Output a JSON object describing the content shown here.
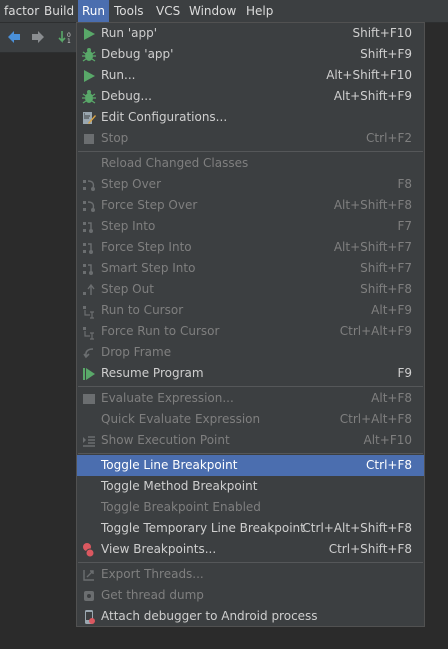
{
  "menubar": {
    "items": [
      {
        "label": "factor"
      },
      {
        "label": "Build"
      },
      {
        "label": "Run"
      },
      {
        "label": "Tools"
      },
      {
        "label": "VCS"
      },
      {
        "label": "Window"
      },
      {
        "label": "Help"
      }
    ]
  },
  "toolbar": {
    "icons": [
      "back-arrow-icon",
      "forward-arrow-icon",
      "sort-icon"
    ]
  },
  "run_menu": {
    "items": [
      {
        "label": "Run 'app'",
        "shortcut": "Shift+F10",
        "icon": "run-icon",
        "enabled": true
      },
      {
        "label": "Debug 'app'",
        "shortcut": "Shift+F9",
        "icon": "debug-icon",
        "enabled": true
      },
      {
        "label": "Run...",
        "shortcut": "Alt+Shift+F10",
        "icon": "run-icon",
        "enabled": true
      },
      {
        "label": "Debug...",
        "shortcut": "Alt+Shift+F9",
        "icon": "debug-icon",
        "enabled": true
      },
      {
        "label": "Edit Configurations...",
        "shortcut": "",
        "icon": "edit-config-icon",
        "enabled": true
      },
      {
        "label": "Stop",
        "shortcut": "Ctrl+F2",
        "icon": "stop-icon",
        "enabled": false
      },
      {
        "label": "Reload Changed Classes",
        "shortcut": "",
        "icon": "",
        "enabled": false
      },
      {
        "label": "Step Over",
        "shortcut": "F8",
        "icon": "step-over-icon",
        "enabled": false
      },
      {
        "label": "Force Step Over",
        "shortcut": "Alt+Shift+F8",
        "icon": "force-step-over-icon",
        "enabled": false
      },
      {
        "label": "Step Into",
        "shortcut": "F7",
        "icon": "step-into-icon",
        "enabled": false
      },
      {
        "label": "Force Step Into",
        "shortcut": "Alt+Shift+F7",
        "icon": "force-step-into-icon",
        "enabled": false
      },
      {
        "label": "Smart Step Into",
        "shortcut": "Shift+F7",
        "icon": "smart-step-into-icon",
        "enabled": false
      },
      {
        "label": "Step Out",
        "shortcut": "Shift+F8",
        "icon": "step-out-icon",
        "enabled": false
      },
      {
        "label": "Run to Cursor",
        "shortcut": "Alt+F9",
        "icon": "run-to-cursor-icon",
        "enabled": false
      },
      {
        "label": "Force Run to Cursor",
        "shortcut": "Ctrl+Alt+F9",
        "icon": "force-run-to-cursor-icon",
        "enabled": false
      },
      {
        "label": "Drop Frame",
        "shortcut": "",
        "icon": "drop-frame-icon",
        "enabled": false
      },
      {
        "label": "Resume Program",
        "shortcut": "F9",
        "icon": "resume-icon",
        "enabled": true
      },
      {
        "label": "Evaluate Expression...",
        "shortcut": "Alt+F8",
        "icon": "evaluate-icon",
        "enabled": false
      },
      {
        "label": "Quick Evaluate Expression",
        "shortcut": "Ctrl+Alt+F8",
        "icon": "",
        "enabled": false
      },
      {
        "label": "Show Execution Point",
        "shortcut": "Alt+F10",
        "icon": "execution-point-icon",
        "enabled": false
      },
      {
        "label": "Toggle Line Breakpoint",
        "shortcut": "Ctrl+F8",
        "icon": "",
        "enabled": true,
        "highlighted": true
      },
      {
        "label": "Toggle Method Breakpoint",
        "shortcut": "",
        "icon": "",
        "enabled": true
      },
      {
        "label": "Toggle Breakpoint Enabled",
        "shortcut": "",
        "icon": "",
        "enabled": false
      },
      {
        "label": "Toggle Temporary Line Breakpoint",
        "shortcut": "Ctrl+Alt+Shift+F8",
        "icon": "",
        "enabled": true
      },
      {
        "label": "View Breakpoints...",
        "shortcut": "Ctrl+Shift+F8",
        "icon": "breakpoints-icon",
        "enabled": true
      },
      {
        "label": "Export Threads...",
        "shortcut": "",
        "icon": "export-threads-icon",
        "enabled": false
      },
      {
        "label": "Get thread dump",
        "shortcut": "",
        "icon": "thread-dump-icon",
        "enabled": false
      },
      {
        "label": "Attach debugger to Android process",
        "shortcut": "",
        "icon": "attach-debugger-icon",
        "enabled": true
      }
    ]
  },
  "colors": {
    "menu_bg": "#3c3f41",
    "highlight": "#4b6eaf",
    "run_green": "#59a869",
    "breakpoint_red": "#db5860"
  }
}
